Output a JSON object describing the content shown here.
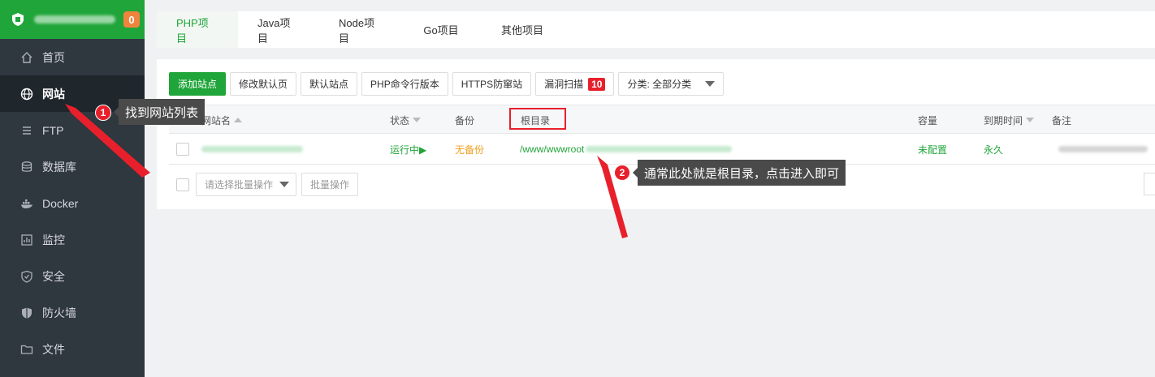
{
  "sidebar": {
    "badge": "0",
    "items": [
      {
        "label": "首页",
        "icon": "home-icon"
      },
      {
        "label": "网站",
        "icon": "globe-icon",
        "active": true
      },
      {
        "label": "FTP",
        "icon": "ftp-icon"
      },
      {
        "label": "数据库",
        "icon": "database-icon"
      },
      {
        "label": "Docker",
        "icon": "docker-icon"
      },
      {
        "label": "监控",
        "icon": "monitor-icon"
      },
      {
        "label": "安全",
        "icon": "shield-icon"
      },
      {
        "label": "防火墙",
        "icon": "firewall-icon"
      },
      {
        "label": "文件",
        "icon": "folder-icon"
      }
    ]
  },
  "tabs": [
    "PHP项目",
    "Java项目",
    "Node项目",
    "Go项目",
    "其他项目"
  ],
  "toolbar": {
    "add_site": "添加站点",
    "modify_default_page": "修改默认页",
    "default_site": "默认站点",
    "php_cli_version": "PHP命令行版本",
    "https_protection": "HTTPS防窜站",
    "vuln_scan": "漏洞扫描",
    "vuln_count": "10",
    "category_select": "分类: 全部分类"
  },
  "table": {
    "headers": {
      "site_name": "网站名",
      "status": "状态",
      "backup": "备份",
      "root_dir": "根目录",
      "capacity": "容量",
      "expiry": "到期时间",
      "note": "备注"
    },
    "rows": [
      {
        "status": "运行中▶",
        "backup": "无备份",
        "root_dir": "/www/wwwroot",
        "capacity": "未配置",
        "expiry": "永久"
      }
    ]
  },
  "batch": {
    "select_placeholder": "请选择批量操作",
    "button": "批量操作"
  },
  "annotations": {
    "step1_num": "1",
    "step1_text": "找到网站列表",
    "step2_num": "2",
    "step2_text": "通常此处就是根目录，点击进入即可"
  },
  "colors": {
    "brand_green": "#20a53a",
    "sidebar_bg": "#2f373f",
    "annotation_red": "#e8202c",
    "badge_orange": "#f0843c"
  }
}
